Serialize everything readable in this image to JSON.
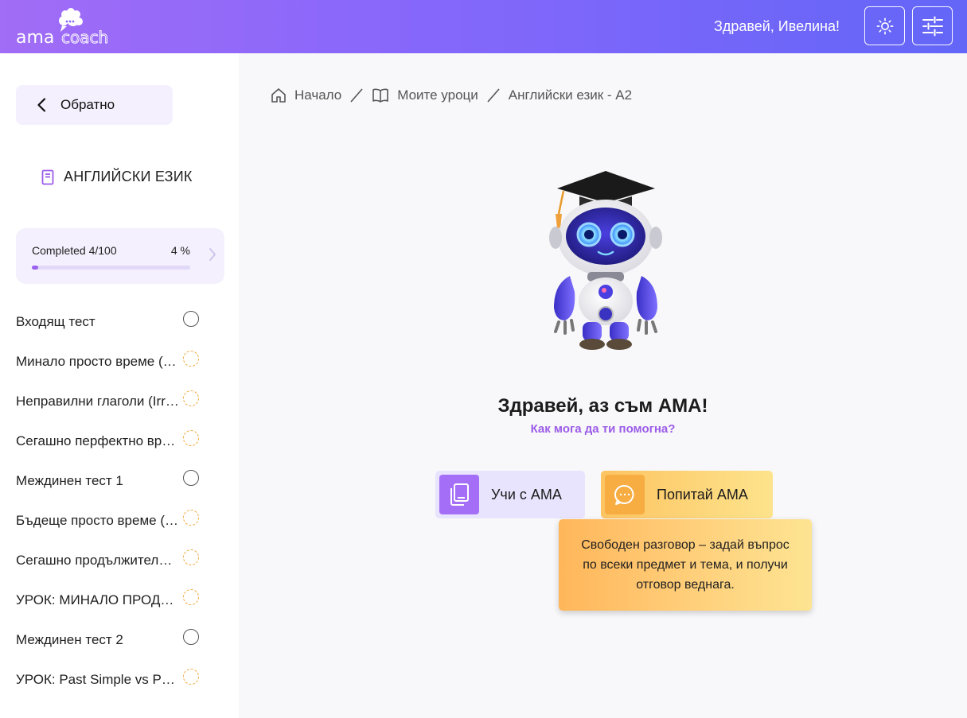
{
  "header": {
    "logo_text_left": "ama",
    "logo_text_right": "coach",
    "greeting": "Здравей, Ивелина!",
    "theme_icon": "sun-icon",
    "settings_icon": "sliders-icon"
  },
  "sidebar": {
    "back_label": "Обратно",
    "course_title": "АНГЛИЙСКИ ЕЗИК",
    "progress": {
      "label": "Completed 4/100",
      "percent_text": "4 %",
      "fraction": 0.04
    },
    "lessons": [
      {
        "label": "Входящ тест",
        "status": "not-started"
      },
      {
        "label": "Минало просто време (Past Simple)",
        "status": "in-progress"
      },
      {
        "label": "Неправилни глаголи (Irregular verbs)",
        "status": "in-progress"
      },
      {
        "label": "Сегашно перфектно време",
        "status": "in-progress"
      },
      {
        "label": "Междинен тест 1",
        "status": "not-started"
      },
      {
        "label": "Бъдеще просто време (Future Simple)",
        "status": "in-progress"
      },
      {
        "label": "Сегашно продължително време",
        "status": "in-progress"
      },
      {
        "label": "УРОК: МИНАЛО ПРОДЪЛЖИТЕЛНО",
        "status": "in-progress"
      },
      {
        "label": "Междинен тест 2",
        "status": "not-started"
      },
      {
        "label": "УРОК: Past Simple vs Present Perfect",
        "status": "in-progress"
      }
    ]
  },
  "breadcrumb": {
    "home": "Начало",
    "lessons": "Моите уроци",
    "current": "Английски език - A2"
  },
  "hero": {
    "title": "Здравей, аз съм АМА!",
    "subtitle": "Как мога да ти помогна?"
  },
  "actions": {
    "learn_label": "Учи с АМА",
    "ask_label": "Попитай АМА",
    "tooltip": "Свободен разговор – задай въпрос по всеки предмет и тема, и получи отговор веднага."
  },
  "colors": {
    "accent": "#9b5ce8",
    "header_start": "#a16cf6",
    "header_end": "#6366f7",
    "in_progress": "#f0a63a"
  }
}
